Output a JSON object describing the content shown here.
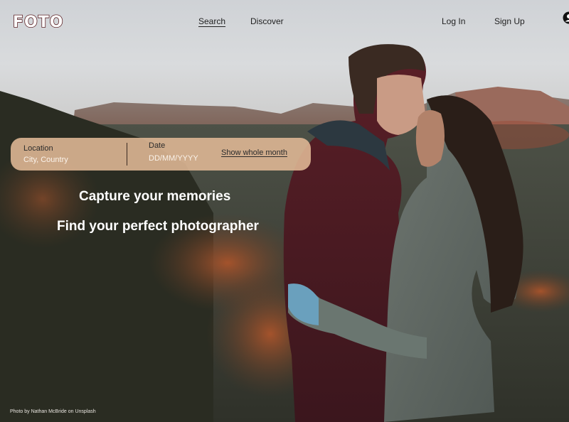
{
  "header": {
    "logo": "FOTO",
    "nav": [
      {
        "label": "Search",
        "active": true
      },
      {
        "label": "Discover",
        "active": false
      },
      {
        "label": "Log In",
        "active": false
      },
      {
        "label": "Sign Up",
        "active": false
      }
    ]
  },
  "search": {
    "location_label": "Location",
    "location_placeholder": "City, Country",
    "date_label": "Date",
    "date_placeholder": "DD/MM/YYYY",
    "month_link": "Show whole month"
  },
  "hero": {
    "tagline_1": "Capture your memories",
    "tagline_2": "Find your perfect photographer",
    "photo_credit": "Photo by Nathan McBride on Unsplash"
  },
  "colors": {
    "brand": "#5a2024",
    "search_bar": "#e1ba96",
    "text_light": "#ffffff"
  },
  "icons": {
    "account": "user-icon"
  }
}
